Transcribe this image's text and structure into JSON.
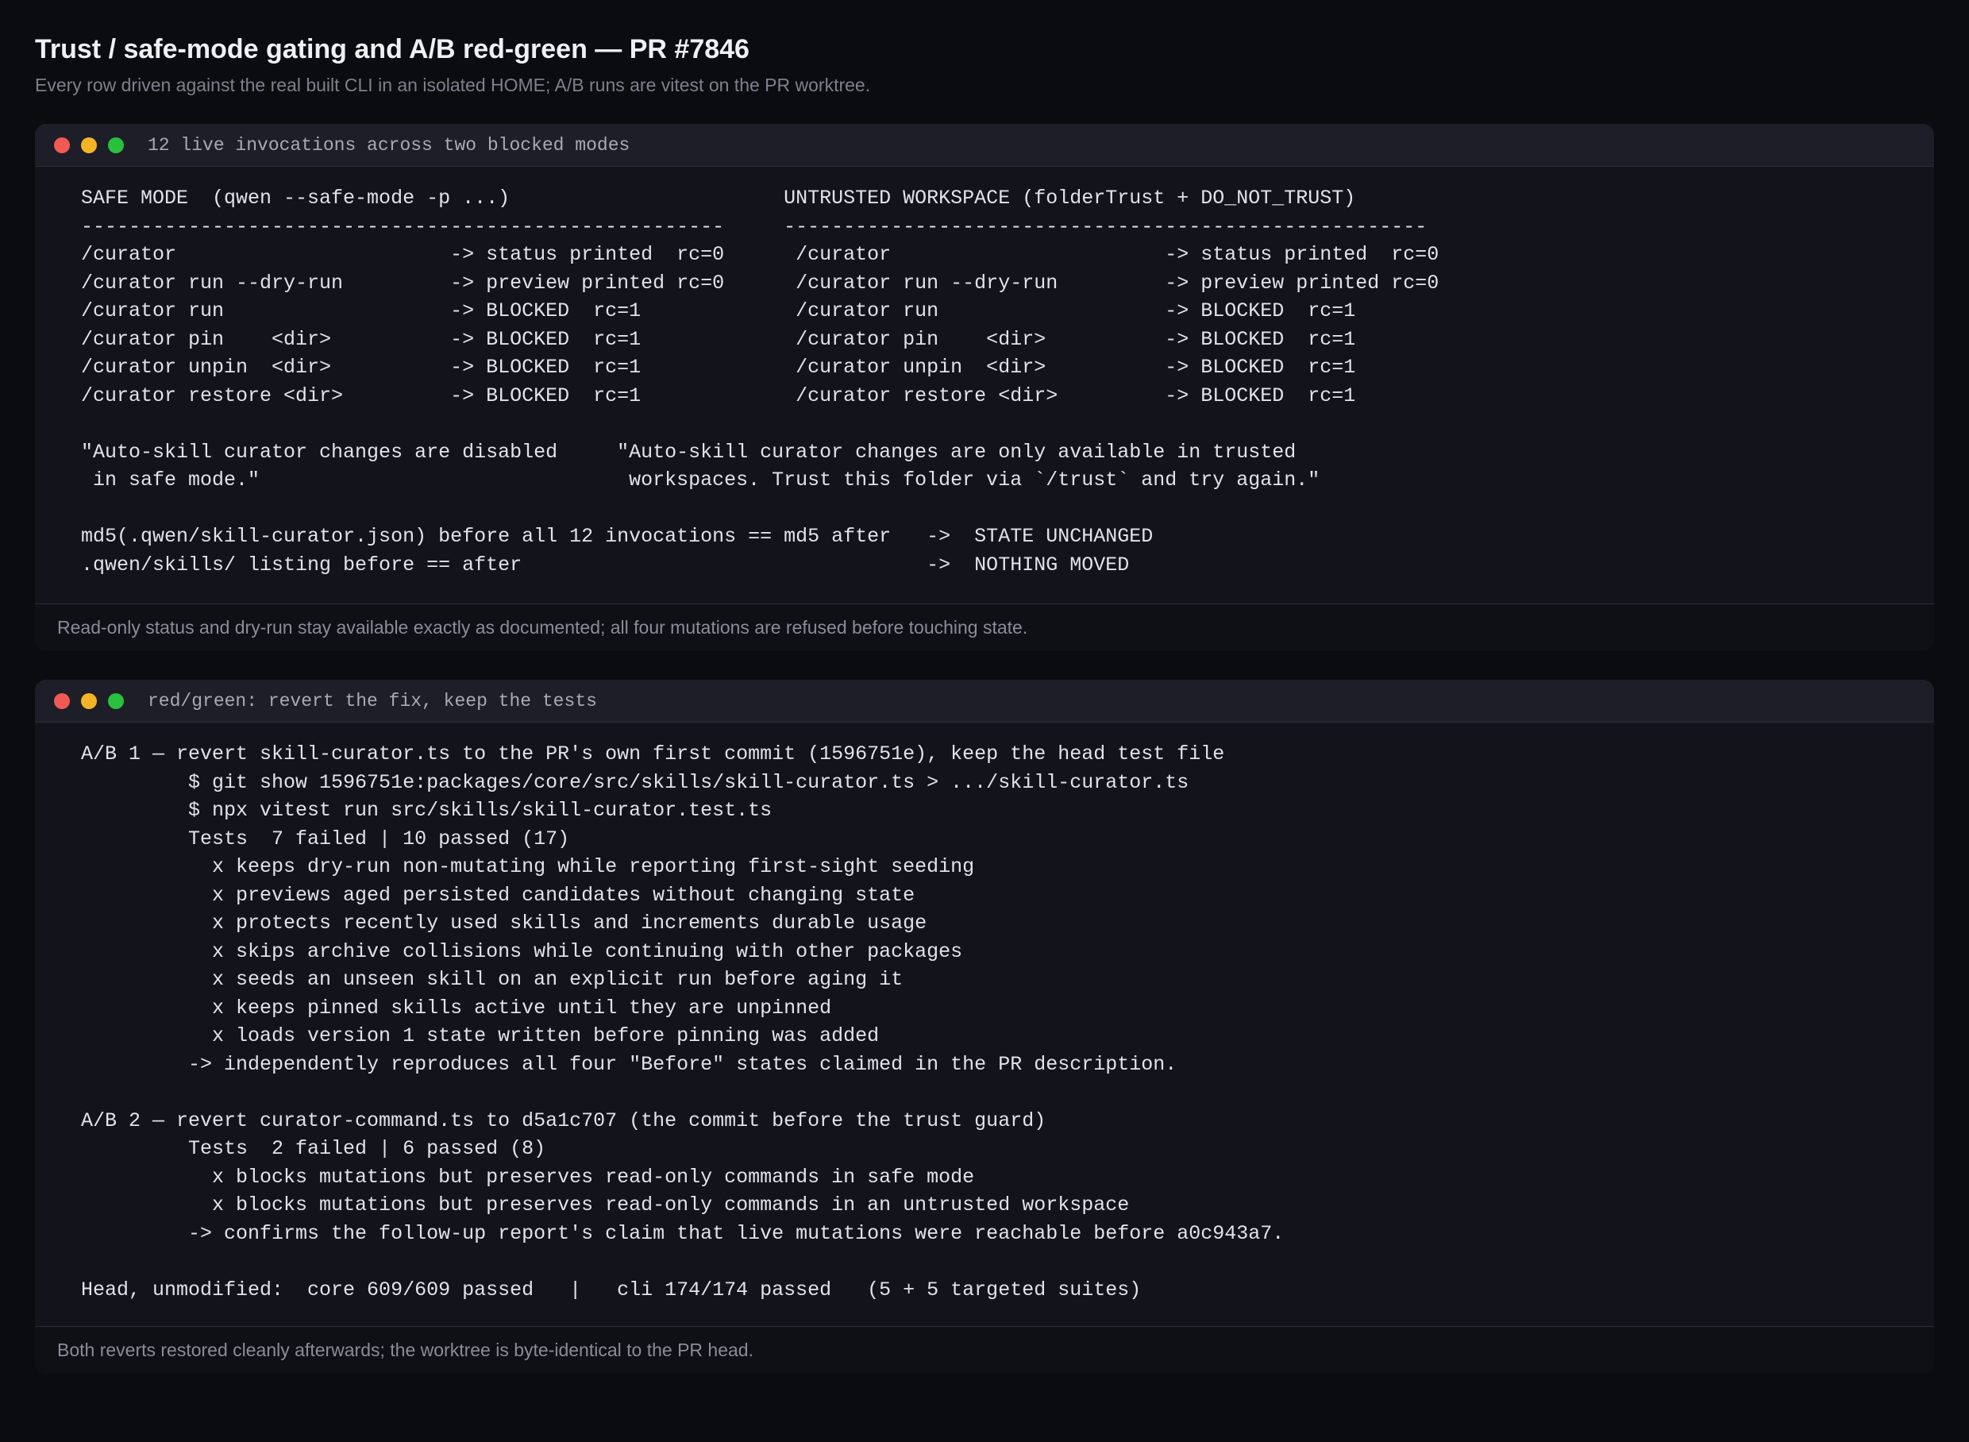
{
  "header": {
    "title": "Trust / safe-mode gating and A/B red-green — PR #7846",
    "subtitle": "Every row driven against the real built CLI in an isolated HOME; A/B runs are vitest on the PR worktree."
  },
  "panels": [
    {
      "window_title": "12 live invocations across two blocked modes",
      "lines": [
        "SAFE MODE  (qwen --safe-mode -p ...)                       UNTRUSTED WORKSPACE (folderTrust + DO_NOT_TRUST)",
        "------------------------------------------------------     ------------------------------------------------------",
        "/curator                       -> status printed  rc=0      /curator                       -> status printed  rc=0",
        "/curator run --dry-run         -> preview printed rc=0      /curator run --dry-run         -> preview printed rc=0",
        "/curator run                   -> BLOCKED  rc=1             /curator run                   -> BLOCKED  rc=1",
        "/curator pin    <dir>          -> BLOCKED  rc=1             /curator pin    <dir>          -> BLOCKED  rc=1",
        "/curator unpin  <dir>          -> BLOCKED  rc=1             /curator unpin  <dir>          -> BLOCKED  rc=1",
        "/curator restore <dir>         -> BLOCKED  rc=1             /curator restore <dir>         -> BLOCKED  rc=1",
        "",
        "\"Auto-skill curator changes are disabled     \"Auto-skill curator changes are only available in trusted",
        " in safe mode.\"                               workspaces. Trust this folder via `/trust` and try again.\"",
        "",
        "md5(.qwen/skill-curator.json) before all 12 invocations == md5 after   ->  STATE UNCHANGED",
        ".qwen/skills/ listing before == after                                  ->  NOTHING MOVED"
      ],
      "footer": "Read-only status and dry-run stay available exactly as documented; all four mutations are refused before touching state."
    },
    {
      "window_title": "red/green: revert the fix, keep the tests",
      "lines": [
        "A/B 1 — revert skill-curator.ts to the PR's own first commit (1596751e), keep the head test file",
        "         $ git show 1596751e:packages/core/src/skills/skill-curator.ts > .../skill-curator.ts",
        "         $ npx vitest run src/skills/skill-curator.test.ts",
        "         Tests  7 failed | 10 passed (17)",
        "           x keeps dry-run non-mutating while reporting first-sight seeding",
        "           x previews aged persisted candidates without changing state",
        "           x protects recently used skills and increments durable usage",
        "           x skips archive collisions while continuing with other packages",
        "           x seeds an unseen skill on an explicit run before aging it",
        "           x keeps pinned skills active until they are unpinned",
        "           x loads version 1 state written before pinning was added",
        "         -> independently reproduces all four \"Before\" states claimed in the PR description.",
        "",
        "A/B 2 — revert curator-command.ts to d5a1c707 (the commit before the trust guard)",
        "         Tests  2 failed | 6 passed (8)",
        "           x blocks mutations but preserves read-only commands in safe mode",
        "           x blocks mutations but preserves read-only commands in an untrusted workspace",
        "         -> confirms the follow-up report's claim that live mutations were reachable before a0c943a7.",
        "",
        "Head, unmodified:  core 609/609 passed   |   cli 174/174 passed   (5 + 5 targeted suites)"
      ],
      "footer": "Both reverts restored cleanly afterwards; the worktree is byte-identical to the PR head."
    }
  ]
}
